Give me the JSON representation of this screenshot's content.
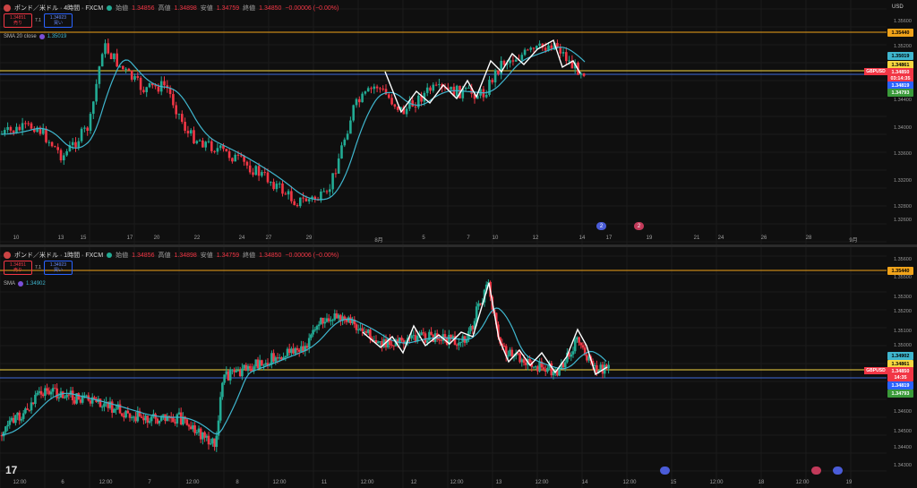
{
  "toolbar": {
    "icons": [
      "horizontal-line-icon",
      "trend-line-icon",
      "pencil-icon",
      "fib-icon",
      "rectangle-icon",
      "circle-icon",
      "arrow-up-icon",
      "arrow-down-icon",
      "measure-icon",
      "image-icon",
      "settings-icon"
    ]
  },
  "pane1": {
    "symbol": "ポンド／米ドル · 4時間 · FXCM",
    "ohlc": [
      {
        "k": "始値",
        "v": "1.34856"
      },
      {
        "k": "高値",
        "v": "1.34898"
      },
      {
        "k": "安値",
        "v": "1.34759"
      },
      {
        "k": "終値",
        "v": "1.34850"
      }
    ],
    "change": "−0.00006 (−0.00%)",
    "sell_price": "1.34851",
    "sell_label": "売り",
    "spread": "7.1",
    "buy_price": "1.34923",
    "buy_label": "買い",
    "sma_label": "SMA 20 close",
    "sma_value": "1.35019",
    "currency": "USD",
    "price_ticks": [
      "1.35600",
      "1.35200",
      "1.34800",
      "1.34400",
      "1.34000",
      "1.33600",
      "1.33200",
      "1.32800",
      "1.32600"
    ],
    "tags": [
      {
        "text": "1.35440",
        "bg": "#f0a31a",
        "fg": "#000"
      },
      {
        "text": "1.35019",
        "bg": "#3fb6ce",
        "fg": "#000"
      },
      {
        "text": "1.34861",
        "bg": "#f7d740",
        "fg": "#000"
      },
      {
        "text": "1.34850",
        "bg": "#f23645",
        "fg": "#fff"
      },
      {
        "text": "03:14:35",
        "bg": "#f23645",
        "fg": "#fff"
      },
      {
        "text": "1.34819",
        "bg": "#2962ff",
        "fg": "#fff"
      },
      {
        "text": "1.34793",
        "bg": "#3a9a3a",
        "fg": "#fff"
      }
    ],
    "symbol_tag": "GBPUSD",
    "x_ticks": [
      "10",
      "13",
      "15",
      "17",
      "20",
      "22",
      "24",
      "27",
      "29",
      "8月",
      "5",
      "7",
      "10",
      "12",
      "14",
      "17",
      "19",
      "21",
      "24",
      "26",
      "28",
      "9月"
    ],
    "events": [
      "2",
      "2"
    ]
  },
  "pane2": {
    "symbol": "ポンド／米ドル · 1時間 · FXCM",
    "ohlc": [
      {
        "k": "始値",
        "v": "1.34856"
      },
      {
        "k": "高値",
        "v": "1.34898"
      },
      {
        "k": "安値",
        "v": "1.34759"
      },
      {
        "k": "終値",
        "v": "1.34850"
      }
    ],
    "change": "−0.00006 (−0.00%)",
    "sell_price": "1.34851",
    "sell_label": "売り",
    "spread": "7.1",
    "buy_price": "1.34923",
    "buy_label": "買い",
    "sma_label": "SMA",
    "sma_value": "1.34902",
    "price_ticks": [
      "1.35600",
      "1.35500",
      "1.35300",
      "1.35200",
      "1.35100",
      "1.35000",
      "1.34900",
      "1.34700",
      "1.34600",
      "1.34500",
      "1.34400",
      "1.34300"
    ],
    "tags": [
      {
        "text": "1.35440",
        "bg": "#f0a31a",
        "fg": "#000"
      },
      {
        "text": "1.34902",
        "bg": "#3fb6ce",
        "fg": "#000"
      },
      {
        "text": "1.34861",
        "bg": "#f7d740",
        "fg": "#000"
      },
      {
        "text": "1.34850",
        "bg": "#f23645",
        "fg": "#fff"
      },
      {
        "text": "14:35",
        "bg": "#f23645",
        "fg": "#fff"
      },
      {
        "text": "1.34819",
        "bg": "#2962ff",
        "fg": "#fff"
      },
      {
        "text": "1.34793",
        "bg": "#3a9a3a",
        "fg": "#fff"
      }
    ],
    "symbol_tag": "GBPUSD",
    "x_ticks": [
      "12:00",
      "6",
      "12:00",
      "7",
      "12:00",
      "8",
      "12:00",
      "11",
      "12:00",
      "12",
      "12:00",
      "13",
      "12:00",
      "14",
      "12:00",
      "15",
      "12:00",
      "18",
      "12:00",
      "19"
    ]
  },
  "colors": {
    "up": "#22ab94",
    "down": "#f23645",
    "sma": "#3fb6ce",
    "orange_line": "#f0a31a"
  },
  "tv_logo": "17"
}
